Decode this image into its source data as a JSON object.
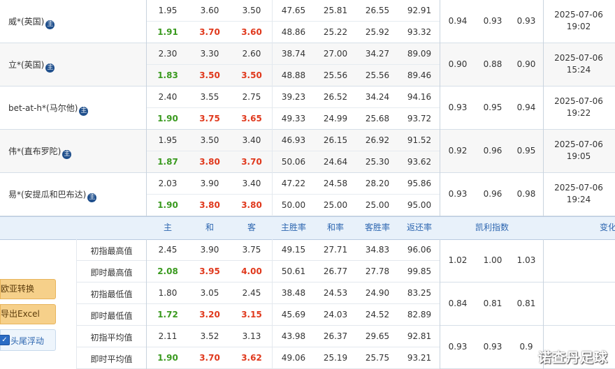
{
  "companies": [
    {
      "name": "威*(英国)",
      "open": [
        "1.95",
        "3.60",
        "3.50",
        "47.65",
        "25.81",
        "26.55",
        "92.91"
      ],
      "live": [
        "1.91",
        "3.70",
        "3.60",
        "48.86",
        "25.22",
        "25.92",
        "93.32"
      ],
      "kelly": [
        "0.94",
        "0.93",
        "0.93"
      ],
      "date": "2025-07-06",
      "time": "19:02"
    },
    {
      "name": "立*(英国)",
      "open": [
        "2.30",
        "3.30",
        "2.60",
        "38.74",
        "27.00",
        "34.27",
        "89.09"
      ],
      "live": [
        "1.83",
        "3.50",
        "3.50",
        "48.88",
        "25.56",
        "25.56",
        "89.46"
      ],
      "kelly": [
        "0.90",
        "0.88",
        "0.90"
      ],
      "date": "2025-07-06",
      "time": "15:24"
    },
    {
      "name": "bet-at-h*(马尔他)",
      "open": [
        "2.40",
        "3.55",
        "2.75",
        "39.23",
        "26.52",
        "34.24",
        "94.16"
      ],
      "live": [
        "1.90",
        "3.75",
        "3.65",
        "49.33",
        "24.99",
        "25.68",
        "93.72"
      ],
      "kelly": [
        "0.93",
        "0.95",
        "0.94"
      ],
      "date": "2025-07-06",
      "time": "19:22"
    },
    {
      "name": "伟*(直布罗陀)",
      "open": [
        "1.95",
        "3.50",
        "3.40",
        "46.93",
        "26.15",
        "26.92",
        "91.52"
      ],
      "live": [
        "1.87",
        "3.80",
        "3.70",
        "50.06",
        "24.64",
        "25.30",
        "93.62"
      ],
      "kelly": [
        "0.92",
        "0.96",
        "0.95"
      ],
      "date": "2025-07-06",
      "time": "19:05"
    },
    {
      "name": "易*(安提瓜和巴布达)",
      "open": [
        "2.03",
        "3.90",
        "3.40",
        "47.22",
        "24.58",
        "28.20",
        "95.86"
      ],
      "live": [
        "1.90",
        "3.80",
        "3.80",
        "50.00",
        "25.00",
        "25.00",
        "95.00"
      ],
      "kelly": [
        "0.93",
        "0.96",
        "0.98"
      ],
      "date": "2025-07-06",
      "time": "19:24"
    }
  ],
  "main_icon": "主",
  "header": {
    "home": "主",
    "draw": "和",
    "away": "客",
    "home_rate": "主胜率",
    "draw_rate": "和率",
    "away_rate": "客胜率",
    "return_rate": "返还率",
    "kelly": "凯利指数",
    "change": "变化"
  },
  "stats": [
    {
      "label": "初指最高值",
      "vals": [
        "2.45",
        "3.90",
        "3.75",
        "49.15",
        "27.71",
        "34.83",
        "96.06"
      ],
      "style": "plain"
    },
    {
      "label": "即时最高值",
      "vals": [
        "2.08",
        "3.95",
        "4.00",
        "50.61",
        "26.77",
        "27.78",
        "99.85"
      ],
      "style": "color"
    },
    {
      "label": "初指最低值",
      "vals": [
        "1.80",
        "3.05",
        "2.45",
        "38.48",
        "24.53",
        "24.90",
        "83.25"
      ],
      "style": "plain"
    },
    {
      "label": "即时最低值",
      "vals": [
        "1.72",
        "3.20",
        "3.15",
        "45.69",
        "24.03",
        "24.52",
        "82.89"
      ],
      "style": "color"
    },
    {
      "label": "初指平均值",
      "vals": [
        "2.11",
        "3.52",
        "3.13",
        "43.98",
        "26.37",
        "29.65",
        "92.81"
      ],
      "style": "plain"
    },
    {
      "label": "即时平均值",
      "vals": [
        "1.90",
        "3.70",
        "3.62",
        "49.06",
        "25.19",
        "25.75",
        "93.21"
      ],
      "style": "color"
    }
  ],
  "stat_kelly": [
    [
      "1.02",
      "1.00",
      "1.03"
    ],
    [
      "0.84",
      "0.81",
      "0.81"
    ],
    [
      "0.93",
      "0.93",
      "0.9"
    ]
  ],
  "buttons": {
    "convert": "欧亚转换",
    "export": "导出Excel",
    "float": "头尾浮动",
    "float_check": "✓"
  },
  "watermark": "诺查丹足球",
  "colors": {
    "green": "#3a9a1f",
    "red": "#e0391d",
    "header_bg": "#e8f1fa",
    "button_bg": "#f6d08a",
    "icon_bg": "#1f4f8c"
  }
}
